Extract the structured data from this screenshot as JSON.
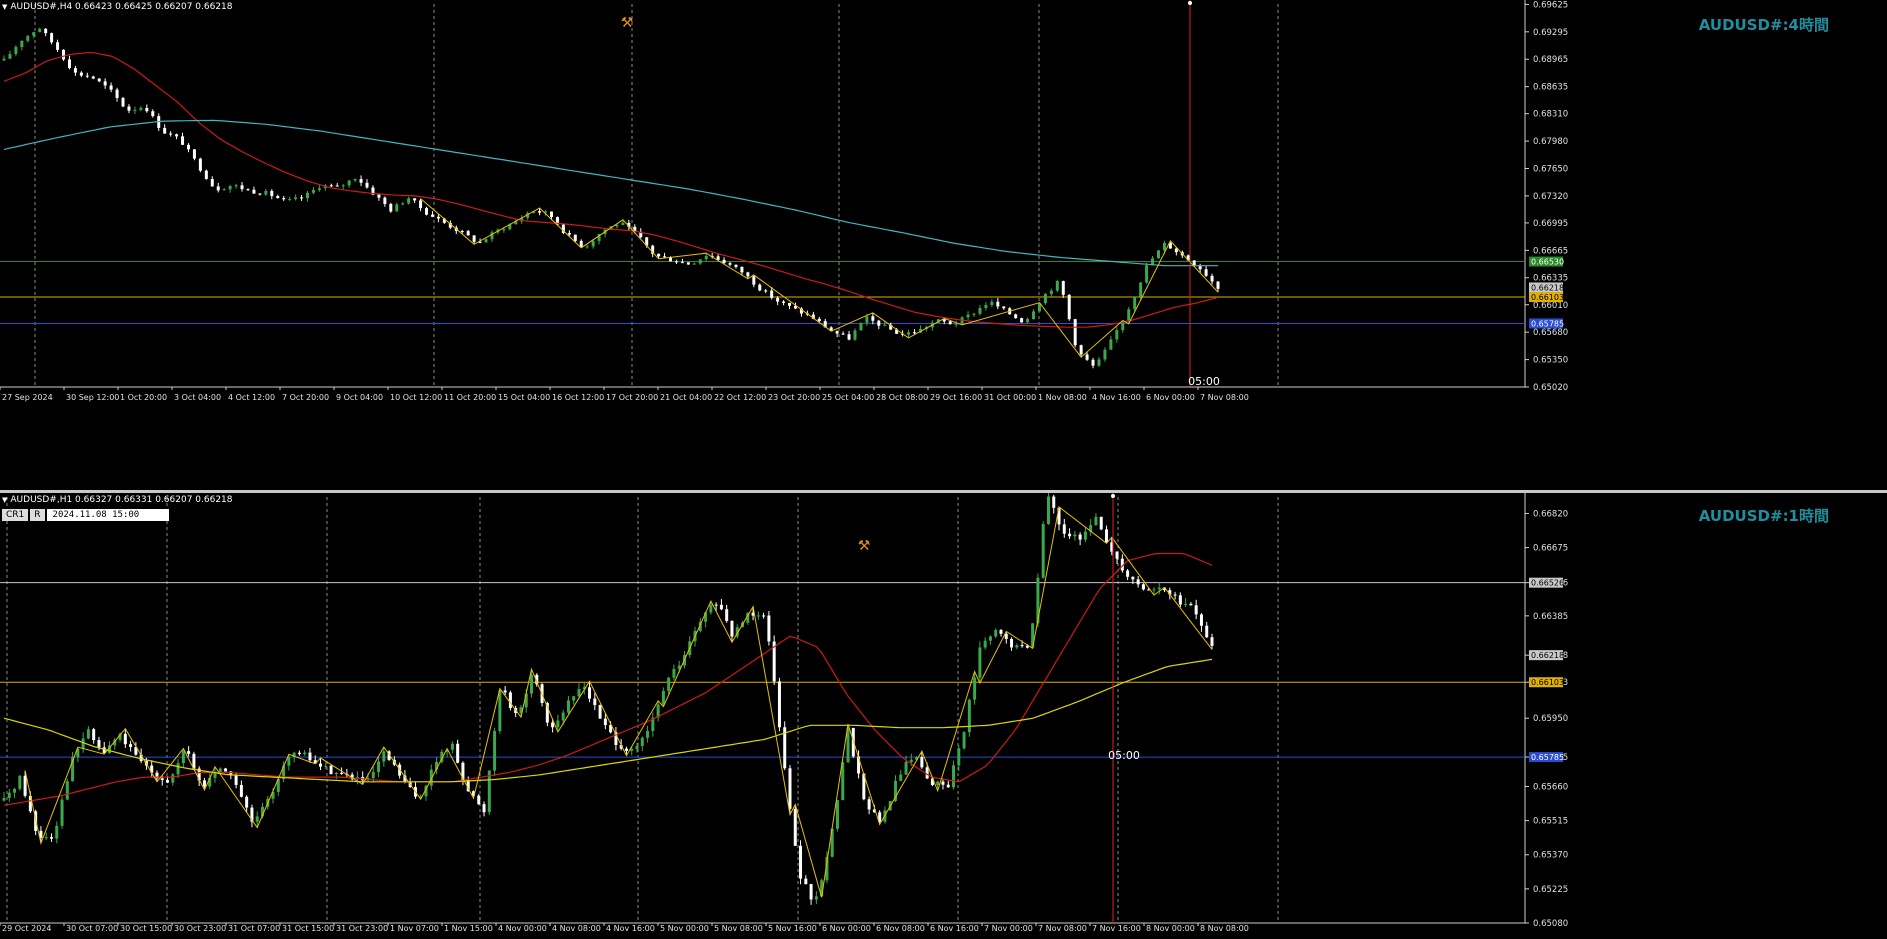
{
  "colors": {
    "bg": "#000000",
    "grid": "#8a8a8a",
    "bull": "#3aa94a",
    "bear": "#ffffff",
    "ma_fast": "#cc1a1a",
    "ma_slow_h4": "#3fb6c4",
    "ma_slow_h1": "#d8d800",
    "zigzag": "#e8c000",
    "level_green": "#2a8a2a",
    "level_yellow": "#e0b000",
    "level_blue": "#2a4cd0",
    "vline": "#e02020",
    "title": "#1f8fa0"
  },
  "panels": [
    {
      "id": "h4",
      "header": "AUDUSD#,H4  0.66423 0.66425 0.66207 0.66218",
      "title": "AUDUSD#:4時間",
      "marker_time": "05:00",
      "price_labels": [
        "0.69625",
        "0.69295",
        "0.68965",
        "0.68635",
        "0.68310",
        "0.67980",
        "0.67650",
        "0.67320",
        "0.66995",
        "0.66665",
        "0.66335",
        "0.66010",
        "0.65680",
        "0.65350",
        "0.65020"
      ],
      "time_labels": [
        "27 Sep 2024",
        "30 Sep 12:00",
        "1 Oct 20:00",
        "3 Oct 04:00",
        "4 Oct 12:00",
        "7 Oct 20:00",
        "9 Oct 04:00",
        "10 Oct 12:00",
        "11 Oct 20:00",
        "15 Oct 04:00",
        "16 Oct 12:00",
        "17 Oct 20:00",
        "21 Oct 04:00",
        "22 Oct 12:00",
        "23 Oct 20:00",
        "25 Oct 04:00",
        "28 Oct 08:00",
        "29 Oct 16:00",
        "31 Oct 00:00",
        "1 Nov 08:00",
        "4 Nov 16:00",
        "6 Nov 00:00",
        "7 Nov 08:00"
      ],
      "level_tags": [
        {
          "value": "0.66530",
          "color": "#2a8a2a",
          "price": 0.6653
        },
        {
          "value": "0.66218",
          "color": "#c8c8c8",
          "price": 0.66218
        },
        {
          "value": "0.66103",
          "color": "#e0b000",
          "price": 0.66103
        },
        {
          "value": "0.65785",
          "color": "#2a4cd0",
          "price": 0.65785
        }
      ]
    },
    {
      "id": "h1",
      "header": "AUDUSD#,H1  0.66327 0.66331 0.66207 0.66218",
      "title": "AUDUSD#:1時間",
      "marker_time": "05:00",
      "cr_labels": [
        "CR1",
        "R"
      ],
      "crosshair_time": "2024.11.08 15:00",
      "price_labels": [
        "0.66820",
        "0.66675",
        "0.66526",
        "0.66385",
        "0.66218",
        "0.66103",
        "0.65950",
        "0.65785",
        "0.65660",
        "0.65515",
        "0.65370",
        "0.65225",
        "0.65080"
      ],
      "time_labels": [
        "29 Oct 2024",
        "30 Oct 07:00",
        "30 Oct 15:00",
        "30 Oct 23:00",
        "31 Oct 07:00",
        "31 Oct 15:00",
        "31 Oct 23:00",
        "1 Nov 07:00",
        "1 Nov 15:00",
        "4 Nov 00:00",
        "4 Nov 08:00",
        "4 Nov 16:00",
        "5 Nov 00:00",
        "5 Nov 08:00",
        "5 Nov 16:00",
        "6 Nov 00:00",
        "6 Nov 08:00",
        "6 Nov 16:00",
        "7 Nov 00:00",
        "7 Nov 08:00",
        "7 Nov 16:00",
        "8 Nov 00:00",
        "8 Nov 08:00"
      ],
      "level_tags": [
        {
          "value": "0.66526",
          "color": "#c8c8c8",
          "price": 0.66526
        },
        {
          "value": "0.66218",
          "color": "#c8c8c8",
          "price": 0.66218
        },
        {
          "value": "0.66103",
          "color": "#e0b000",
          "price": 0.66103
        },
        {
          "value": "0.65785",
          "color": "#2a4cd0",
          "price": 0.65785
        }
      ]
    }
  ],
  "chart_data": [
    {
      "type": "candlestick",
      "title": "AUDUSD#:4時間",
      "ylim": [
        0.6502,
        0.6963
      ],
      "x_range": [
        "27 Sep 2024",
        "8 Nov 2024"
      ],
      "close_path": [
        0.6895,
        0.692,
        0.6935,
        0.691,
        0.688,
        0.6875,
        0.686,
        0.6835,
        0.684,
        0.681,
        0.68,
        0.677,
        0.674,
        0.6745,
        0.6738,
        0.6735,
        0.6725,
        0.673,
        0.6745,
        0.6742,
        0.6755,
        0.6735,
        0.6715,
        0.673,
        0.6712,
        0.67,
        0.6688,
        0.6675,
        0.669,
        0.67,
        0.6715,
        0.671,
        0.6685,
        0.667,
        0.669,
        0.67,
        0.6685,
        0.666,
        0.6655,
        0.665,
        0.6662,
        0.6652,
        0.664,
        0.662,
        0.6605,
        0.6595,
        0.6585,
        0.657,
        0.656,
        0.6585,
        0.6575,
        0.6565,
        0.657,
        0.6582,
        0.6578,
        0.659,
        0.6605,
        0.6592,
        0.658,
        0.661,
        0.663,
        0.6545,
        0.6525,
        0.656,
        0.66,
        0.665,
        0.6675,
        0.666,
        0.6645,
        0.6622
      ],
      "ma_fast_path": [
        0.687,
        0.688,
        0.6895,
        0.6902,
        0.6905,
        0.69,
        0.6885,
        0.6865,
        0.6845,
        0.682,
        0.68,
        0.6785,
        0.6772,
        0.676,
        0.675,
        0.6742,
        0.6738,
        0.6735,
        0.6733,
        0.6732,
        0.6728,
        0.6722,
        0.6715,
        0.6708,
        0.6702,
        0.67,
        0.6698,
        0.6695,
        0.6692,
        0.669,
        0.6685,
        0.6678,
        0.667,
        0.6662,
        0.6655,
        0.6648,
        0.664,
        0.6632,
        0.6625,
        0.6617,
        0.6608,
        0.66,
        0.6592,
        0.6587,
        0.6583,
        0.658,
        0.6578,
        0.6576,
        0.6575,
        0.6574,
        0.6574,
        0.6577,
        0.6582,
        0.659,
        0.6598,
        0.6603,
        0.661
      ],
      "ma_slow_path": [
        0.6788,
        0.6802,
        0.6815,
        0.6822,
        0.6823,
        0.6818,
        0.681,
        0.68,
        0.679,
        0.678,
        0.677,
        0.676,
        0.675,
        0.674,
        0.6728,
        0.6715,
        0.67,
        0.6688,
        0.6675,
        0.6665,
        0.6658,
        0.6653,
        0.6648,
        0.6648
      ],
      "levels": [
        0.6653,
        0.66103,
        0.65785
      ],
      "last": {
        "open": 0.66423,
        "high": 0.66425,
        "low": 0.66207,
        "close": 0.66218
      }
    },
    {
      "type": "candlestick",
      "title": "AUDUSD#:1時間",
      "ylim": [
        0.6508,
        0.6689
      ],
      "x_range": [
        "29 Oct 2024",
        "8 Nov 2024"
      ],
      "close_path": [
        0.656,
        0.657,
        0.6545,
        0.6545,
        0.6575,
        0.659,
        0.658,
        0.6588,
        0.6578,
        0.6572,
        0.6568,
        0.6582,
        0.6565,
        0.6575,
        0.6568,
        0.655,
        0.656,
        0.6578,
        0.658,
        0.6575,
        0.6572,
        0.657,
        0.6568,
        0.658,
        0.657,
        0.656,
        0.6575,
        0.6585,
        0.6565,
        0.6555,
        0.661,
        0.6595,
        0.6615,
        0.659,
        0.66,
        0.661,
        0.6595,
        0.6585,
        0.658,
        0.659,
        0.661,
        0.662,
        0.6635,
        0.6645,
        0.663,
        0.664,
        0.664,
        0.6585,
        0.653,
        0.6515,
        0.6545,
        0.659,
        0.656,
        0.655,
        0.657,
        0.658,
        0.6568,
        0.6565,
        0.659,
        0.6625,
        0.6632,
        0.6625,
        0.6625,
        0.669,
        0.6675,
        0.667,
        0.668,
        0.6665,
        0.6655,
        0.665,
        0.665,
        0.6645,
        0.664,
        0.6625
      ],
      "ma_fast_path": [
        0.6558,
        0.656,
        0.6562,
        0.6565,
        0.6568,
        0.657,
        0.657,
        0.6572,
        0.6572,
        0.6571,
        0.657,
        0.657,
        0.657,
        0.6569,
        0.6568,
        0.6568,
        0.6568,
        0.657,
        0.6572,
        0.6575,
        0.6579,
        0.6584,
        0.6589,
        0.6594,
        0.66,
        0.6606,
        0.6614,
        0.6622,
        0.663,
        0.6625,
        0.6605,
        0.659,
        0.6578,
        0.657,
        0.6568,
        0.6575,
        0.659,
        0.661,
        0.663,
        0.665,
        0.6662,
        0.6665,
        0.6665,
        0.666
      ],
      "ma_slow_path": [
        0.6595,
        0.659,
        0.6583,
        0.6578,
        0.6574,
        0.6571,
        0.657,
        0.6569,
        0.6568,
        0.6568,
        0.6568,
        0.6569,
        0.6571,
        0.6574,
        0.6577,
        0.658,
        0.6583,
        0.6586,
        0.6592,
        0.6592,
        0.6591,
        0.6591,
        0.6592,
        0.6595,
        0.6602,
        0.661,
        0.6617,
        0.662
      ],
      "levels": [
        0.66526,
        0.66103,
        0.65785
      ],
      "last": {
        "open": 0.66327,
        "high": 0.66331,
        "low": 0.66207,
        "close": 0.66218
      }
    }
  ]
}
